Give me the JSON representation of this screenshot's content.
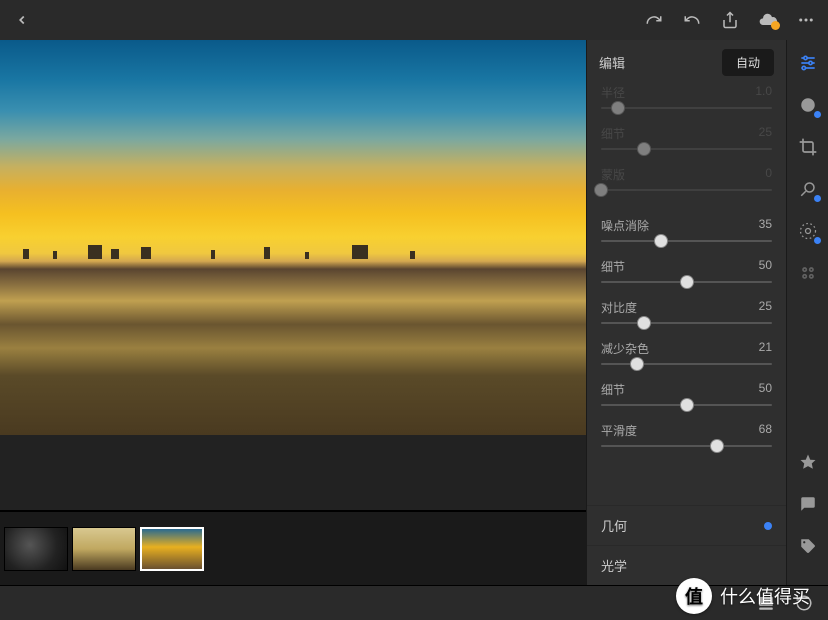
{
  "header": {
    "edit_label": "编辑",
    "auto_label": "自动"
  },
  "sliders": [
    {
      "label": "半径",
      "value": "1.0",
      "pos": 10,
      "dim": true
    },
    {
      "label": "细节",
      "value": "25",
      "pos": 25,
      "dim": true
    },
    {
      "label": "蒙版",
      "value": "0",
      "pos": 0,
      "dim": true
    },
    {
      "label": "噪点消除",
      "value": "35",
      "pos": 35,
      "dim": false
    },
    {
      "label": "细节",
      "value": "50",
      "pos": 50,
      "dim": false
    },
    {
      "label": "对比度",
      "value": "25",
      "pos": 25,
      "dim": false
    },
    {
      "label": "减少杂色",
      "value": "21",
      "pos": 21,
      "dim": false
    },
    {
      "label": "细节",
      "value": "50",
      "pos": 50,
      "dim": false
    },
    {
      "label": "平滑度",
      "value": "68",
      "pos": 68,
      "dim": false
    }
  ],
  "sections": {
    "geometry": "几何",
    "optics": "光学"
  },
  "watermark": {
    "badge": "值",
    "text": "什么值得买"
  }
}
